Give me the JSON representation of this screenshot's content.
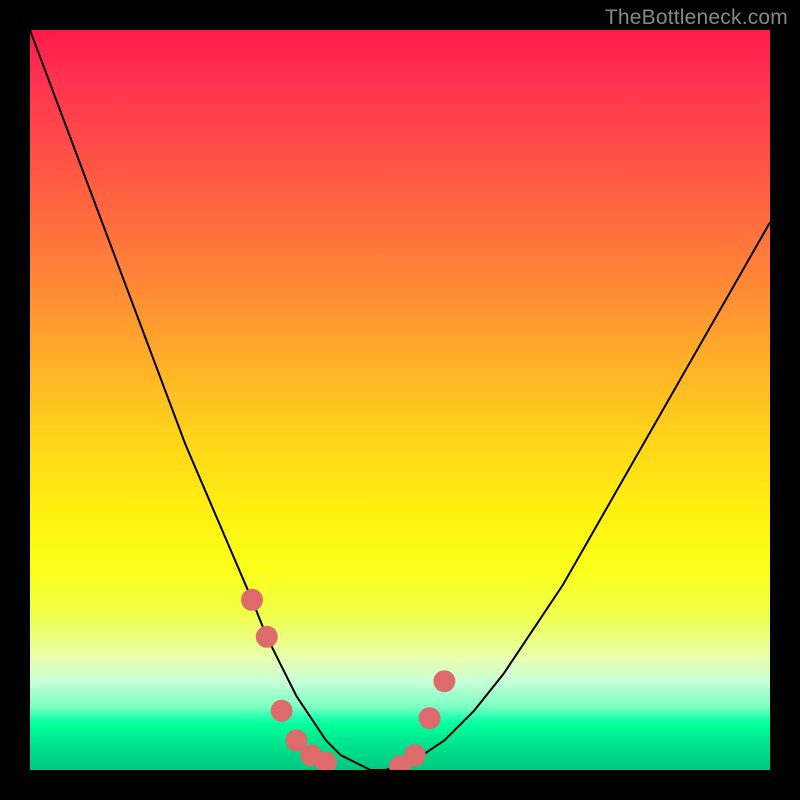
{
  "watermark": "TheBottleneck.com",
  "chart_data": {
    "type": "line",
    "title": "",
    "xlabel": "",
    "ylabel": "",
    "xlim": [
      0,
      100
    ],
    "ylim": [
      0,
      100
    ],
    "x": [
      0,
      3,
      6,
      9,
      12,
      15,
      18,
      21,
      24,
      27,
      30,
      32,
      34,
      36,
      38,
      40,
      42,
      44,
      46,
      48,
      50,
      53,
      56,
      60,
      64,
      68,
      72,
      76,
      80,
      84,
      88,
      92,
      96,
      100
    ],
    "y": [
      100,
      92,
      84,
      76,
      68,
      60,
      52,
      44,
      37,
      30,
      23,
      18,
      14,
      10,
      7,
      4,
      2,
      1,
      0,
      0,
      0.5,
      2,
      4,
      8,
      13,
      19,
      25,
      32,
      39,
      46,
      53,
      60,
      67,
      74
    ],
    "markers": {
      "x": [
        30,
        32,
        34,
        36,
        38,
        40,
        50,
        52,
        54,
        56
      ],
      "y": [
        23,
        18,
        8,
        4,
        2,
        1,
        0.5,
        2,
        7,
        12
      ],
      "color": "#dd6b6b",
      "size": 11
    },
    "curve_color": "#000000",
    "curve_width": 2
  }
}
